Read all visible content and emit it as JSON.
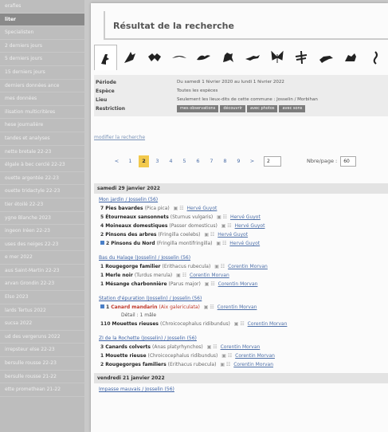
{
  "sidebar": {
    "items": [
      {
        "label": "erafies"
      },
      {
        "label": "liter",
        "active": true
      },
      {
        "label": "Specialisten"
      },
      {
        "label": "2 derniers jours"
      },
      {
        "label": "5 derniers jours"
      },
      {
        "label": "15 derniers jours"
      },
      {
        "label": "derniers données ance"
      },
      {
        "label": "mes données"
      },
      {
        "label": "ilisation multicritères"
      },
      {
        "label": "hese journalière"
      },
      {
        "label": "tandes et analyses"
      },
      {
        "label": "nette bretale 22-23"
      },
      {
        "label": "élgale à bec cerclé 22-23"
      },
      {
        "label": "ouette argentée 22-23"
      },
      {
        "label": "ouette tridactyle 22-23"
      },
      {
        "label": "tier étoilé 22-23"
      },
      {
        "label": "ygne Blanche 2023"
      },
      {
        "label": "ingeon Iréen 22-23"
      },
      {
        "label": "uses des neiges 22-23"
      },
      {
        "label": "e mer 2022"
      },
      {
        "label": "aus Saint-Martin 22-23"
      },
      {
        "label": "arvan Grondin 22-23"
      },
      {
        "label": "Elso 2023"
      },
      {
        "label": "lards Tertus 2022"
      },
      {
        "label": "sucsa 2022"
      },
      {
        "label": "ud des vergeruns 2022"
      },
      {
        "label": "irrepsteur else 22-23"
      },
      {
        "label": "bersulle rousse 22-23"
      },
      {
        "label": "bersulle rousse 21-22"
      },
      {
        "label": "ette promethean 21-22"
      }
    ]
  },
  "title": "Résultat de la recherche",
  "icons": [
    "bird-perched-icon",
    "owl-icon",
    "bat-icon",
    "swift-icon",
    "gull-icon",
    "mammal-icon",
    "lizard-icon",
    "butterfly-icon",
    "dragonfly-icon",
    "locust-icon",
    "fox-icon",
    "seahorse-icon"
  ],
  "criteria": {
    "periode_label": "Période",
    "periode_value": "Du samedi 1 février 2020 au lundi 1 février 2022",
    "espece_label": "Espèce",
    "espece_value": "Toutes les espèces",
    "lieu_label": "Lieu",
    "lieu_value": "Seulement les lieux-dits de cette commune : Josselin / Morbihan",
    "restriction_label": "Restriction",
    "restriction_buttons": [
      "mes observations",
      "découvrir",
      "avec photos",
      "avec sons"
    ]
  },
  "modify_link": "modifier la recherche",
  "pager": {
    "prev": "<",
    "pages": [
      "1",
      "2",
      "3",
      "4",
      "5",
      "6",
      "7",
      "8",
      "9"
    ],
    "current": "2",
    "next": ">",
    "goto_value": "2",
    "nb_label": "Nbre/page :",
    "nb_value": "60"
  },
  "days": [
    {
      "date": "samedi 29 janvier 2022",
      "groups": [
        {
          "location": "Mon jardin / Josselin (56)",
          "obs": [
            {
              "q": "7",
              "species": "Pies bavardes",
              "latin": "(Pica pica)",
              "observer": "Hervé Guyot",
              "flag": false
            },
            {
              "q": "5",
              "species": "Étourneaux sansonnets",
              "latin": "(Sturnus vulgaris)",
              "observer": "Hervé Guyot",
              "flag": false
            },
            {
              "q": "4",
              "species": "Moineaux domestiques",
              "latin": "(Passer domesticus)",
              "observer": "Hervé Guyot",
              "flag": false
            },
            {
              "q": "2",
              "species": "Pinsons des arbres",
              "latin": "(Fringilla coelebs)",
              "observer": "Hervé Guyot",
              "flag": false
            },
            {
              "q": "2",
              "species": "Pinsons du Nord",
              "latin": "(Fringilla montifringilla)",
              "observer": "Hervé Guyot",
              "flag": true
            }
          ]
        },
        {
          "location": "Bas du Halage (Josselin) / Josselin (56)",
          "obs": [
            {
              "q": "1",
              "species": "Rougegorge familier",
              "latin": "(Erithacus rubecula)",
              "observer": "Corentin Morvan",
              "flag": false
            },
            {
              "q": "1",
              "species": "Merle noir",
              "latin": "(Turdus merula)",
              "observer": "Corentin Morvan",
              "flag": false
            },
            {
              "q": "1",
              "species": "Mésange charbonnière",
              "latin": "(Parus major)",
              "observer": "Corentin Morvan",
              "flag": false
            }
          ]
        },
        {
          "location": "Station d'épuration (Josselin) / Josselin (56)",
          "obs": [
            {
              "q": "1",
              "species": "Canard mandarin",
              "latin": "(Aix galericulata)",
              "observer": "Corentin Morvan",
              "flag": true,
              "red": true
            },
            {
              "q": "110",
              "species": "Mouettes rieuses",
              "latin": "(Chroicocephalus ridibundus)",
              "observer": "Corentin Morvan",
              "flag": false
            }
          ],
          "detail": "Détail : 1 mâle"
        },
        {
          "location": "ZI de la Rochette (Josselin) / Josselin (56)",
          "obs": [
            {
              "q": "3",
              "species": "Canards colverts",
              "latin": "(Anas platyrhynchos)",
              "observer": "Corentin Morvan",
              "flag": false
            },
            {
              "q": "1",
              "species": "Mouette rieuse",
              "latin": "(Chroicocephalus ridibundus)",
              "observer": "Corentin Morvan",
              "flag": false
            },
            {
              "q": "2",
              "species": "Rougegorges familiers",
              "latin": "(Erithacus rubecula)",
              "observer": "Corentin Morvan",
              "flag": false
            }
          ]
        }
      ]
    },
    {
      "date": "vendredi 21 janvier 2022",
      "groups": [
        {
          "location": "Impasse mauvais / Josselin (56)",
          "obs": []
        }
      ]
    }
  ]
}
